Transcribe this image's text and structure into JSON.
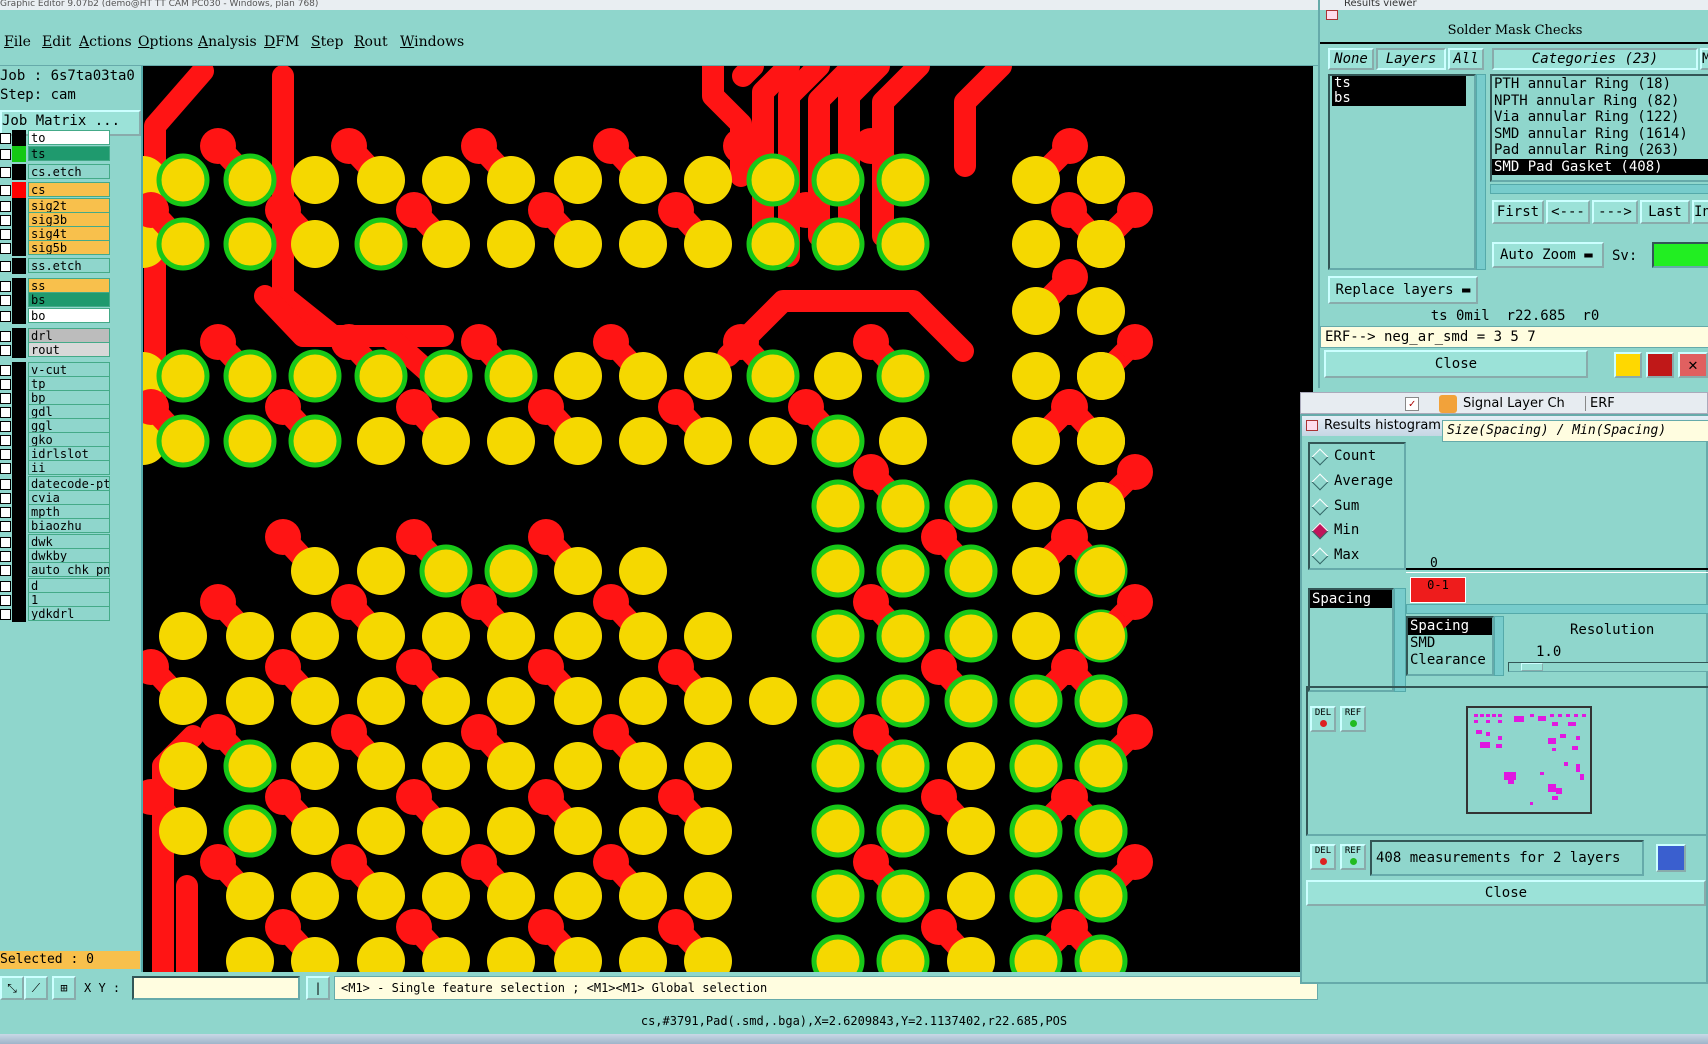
{
  "title_bar": {
    "text": "Graphic Editor 9.07b2 (demo@HT TT CAM PC030 - Windows, plan 768)"
  },
  "menu": [
    "File",
    "Edit",
    "Actions",
    "Options",
    "Analysis",
    "DFM",
    "Step",
    "Rout",
    "Windows"
  ],
  "job": {
    "job_label": "Job : 6s7ta03ta0",
    "step_label": "Step: cam",
    "matrix_button": "Job Matrix ..."
  },
  "layers": [
    {
      "name": "to",
      "bg": "#ffffff",
      "swatch": "#000000"
    },
    {
      "name": "ts",
      "bg": "#1f9a6e",
      "swatch": "#14c814"
    },
    {
      "name": "cs.etch",
      "bg": "#8fd6cc",
      "swatch": "#000000"
    },
    {
      "name": "cs",
      "bg": "#f8c04c",
      "swatch": "#ff0000"
    },
    {
      "name": "sig2t",
      "bg": "#f8c04c",
      "swatch": "#000000"
    },
    {
      "name": "sig3b",
      "bg": "#f8c04c",
      "swatch": "#000000"
    },
    {
      "name": "sig4t",
      "bg": "#f8c04c",
      "swatch": "#000000"
    },
    {
      "name": "sig5b",
      "bg": "#f8c04c",
      "swatch": "#000000"
    },
    {
      "name": "ss.etch",
      "bg": "#8fd6cc",
      "swatch": "#000000"
    },
    {
      "name": "ss",
      "bg": "#f8c04c",
      "swatch": "#000000"
    },
    {
      "name": "bs",
      "bg": "#1f9a6e",
      "swatch": "#000000"
    },
    {
      "name": "bo",
      "bg": "#ffffff",
      "swatch": "#000000"
    },
    {
      "name": "drl",
      "bg": "#bcbcbc",
      "swatch": "#000000"
    },
    {
      "name": "rout",
      "bg": "#d8d8d8",
      "swatch": "#000000"
    },
    {
      "name": "v-cut",
      "bg": "#8fd6cc",
      "swatch": "#000000"
    },
    {
      "name": "tp",
      "bg": "#8fd6cc",
      "swatch": "#000000"
    },
    {
      "name": "bp",
      "bg": "#8fd6cc",
      "swatch": "#000000"
    },
    {
      "name": "gdl",
      "bg": "#8fd6cc",
      "swatch": "#000000"
    },
    {
      "name": "ggl",
      "bg": "#8fd6cc",
      "swatch": "#000000"
    },
    {
      "name": "gko",
      "bg": "#8fd6cc",
      "swatch": "#000000"
    },
    {
      "name": "idrlslot",
      "bg": "#8fd6cc",
      "swatch": "#000000"
    },
    {
      "name": "ii",
      "bg": "#8fd6cc",
      "swatch": "#000000"
    },
    {
      "name": "datecode-pt",
      "bg": "#8fd6cc",
      "swatch": "#000000"
    },
    {
      "name": "cvia",
      "bg": "#8fd6cc",
      "swatch": "#000000"
    },
    {
      "name": "mpth",
      "bg": "#8fd6cc",
      "swatch": "#000000"
    },
    {
      "name": "biaozhu",
      "bg": "#8fd6cc",
      "swatch": "#000000"
    },
    {
      "name": "dwk",
      "bg": "#8fd6cc",
      "swatch": "#000000"
    },
    {
      "name": "dwkby",
      "bg": "#8fd6cc",
      "swatch": "#000000"
    },
    {
      "name": "auto_chk_pn",
      "bg": "#8fd6cc",
      "swatch": "#000000"
    },
    {
      "name": "d",
      "bg": "#8fd6cc",
      "swatch": "#000000"
    },
    {
      "name": "1",
      "bg": "#8fd6cc",
      "swatch": "#000000"
    },
    {
      "name": "ydkdrl",
      "bg": "#8fd6cc",
      "swatch": "#000000"
    }
  ],
  "selected_label": "Selected : 0",
  "command_bar": {
    "xy_label": "X Y :",
    "xy_value": "",
    "hint": "<M1> - Single feature selection ; <M1><M1> Global selection"
  },
  "status_line": "cs,#3791,Pad(.smd,.bga),X=2.6209843,Y=2.1137402,r22.685,POS",
  "results_viewer": {
    "title": "Results viewer",
    "header": "Solder Mask Checks",
    "btn_none": "None",
    "btn_layers": "Layers",
    "btn_all": "All",
    "categories_label": "Categories (23)",
    "layers": [
      "ts",
      "bs"
    ],
    "categories": [
      "PTH annular Ring (18)",
      "NPTH annular Ring (82)",
      "Via annular Ring (122)",
      "SMD annular Ring (1614)",
      "Pad annular Ring (263)",
      "SMD Pad Gasket (408)"
    ],
    "selected_category": 5,
    "nav": [
      "First",
      "<---",
      "--->",
      "Last",
      "In"
    ],
    "auto_zoom": "Auto Zoom",
    "sv_label": "Sv:",
    "replace_layers": "Replace layers",
    "info": "ts 0mil  r22.685  r0",
    "erf": "ERF--> neg_ar_smd = 3 5 7",
    "close": "Close",
    "signal_tab": "Signal Layer Ch",
    "erf_tab": "ERF"
  },
  "histogram": {
    "title": "Results histogram",
    "options": [
      "Count",
      "Average",
      "Sum",
      "Min",
      "Max"
    ],
    "selected_option": "Min",
    "header_text": "Size(Spacing) / Min(Spacing)",
    "list_selected": "Spacing",
    "axis_zero": "0",
    "bar_label": "0-1",
    "spacing_items": [
      "Spacing",
      "SMD",
      "Clearance"
    ],
    "resolution_label": "Resolution",
    "resolution_value": "1.0",
    "measurements": "408 measurements for 2 layers",
    "del": "DEL",
    "ref": "REF",
    "close": "Close"
  },
  "colors": {
    "pad": "#f5d800",
    "trace": "#ff1414",
    "mask_ring": "#18c818",
    "background": "#000000",
    "ui": "#8fd6cc"
  }
}
